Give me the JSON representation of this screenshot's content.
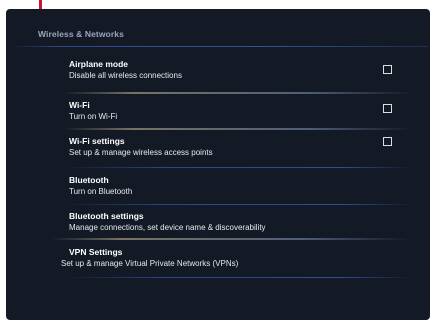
{
  "section": {
    "title": "Wireless & Networks"
  },
  "items": [
    {
      "title": "Airplane mode",
      "summary": "Disable all wireless connections",
      "has_checkbox": true,
      "checked": false
    },
    {
      "title": "Wi-Fi",
      "summary": "Turn on Wi-Fi",
      "has_checkbox": true,
      "checked": false
    },
    {
      "title": "Wi-Fi settings",
      "summary": "Set up & manage wireless access points",
      "has_checkbox": true,
      "checked": false
    },
    {
      "title": "Bluetooth",
      "summary": "Turn on Bluetooth",
      "has_checkbox": false
    },
    {
      "title": "Bluetooth settings",
      "summary": "Manage connections, set device name & discoverability",
      "has_checkbox": false
    },
    {
      "title": "VPN Settings",
      "summary": "Set up & manage Virtual Private Networks (VPNs)",
      "has_checkbox": false
    }
  ],
  "colors": {
    "background": "#131a26",
    "annotation": "#c8162c",
    "text": "#ffffff",
    "header_text": "#9aa6b8"
  }
}
